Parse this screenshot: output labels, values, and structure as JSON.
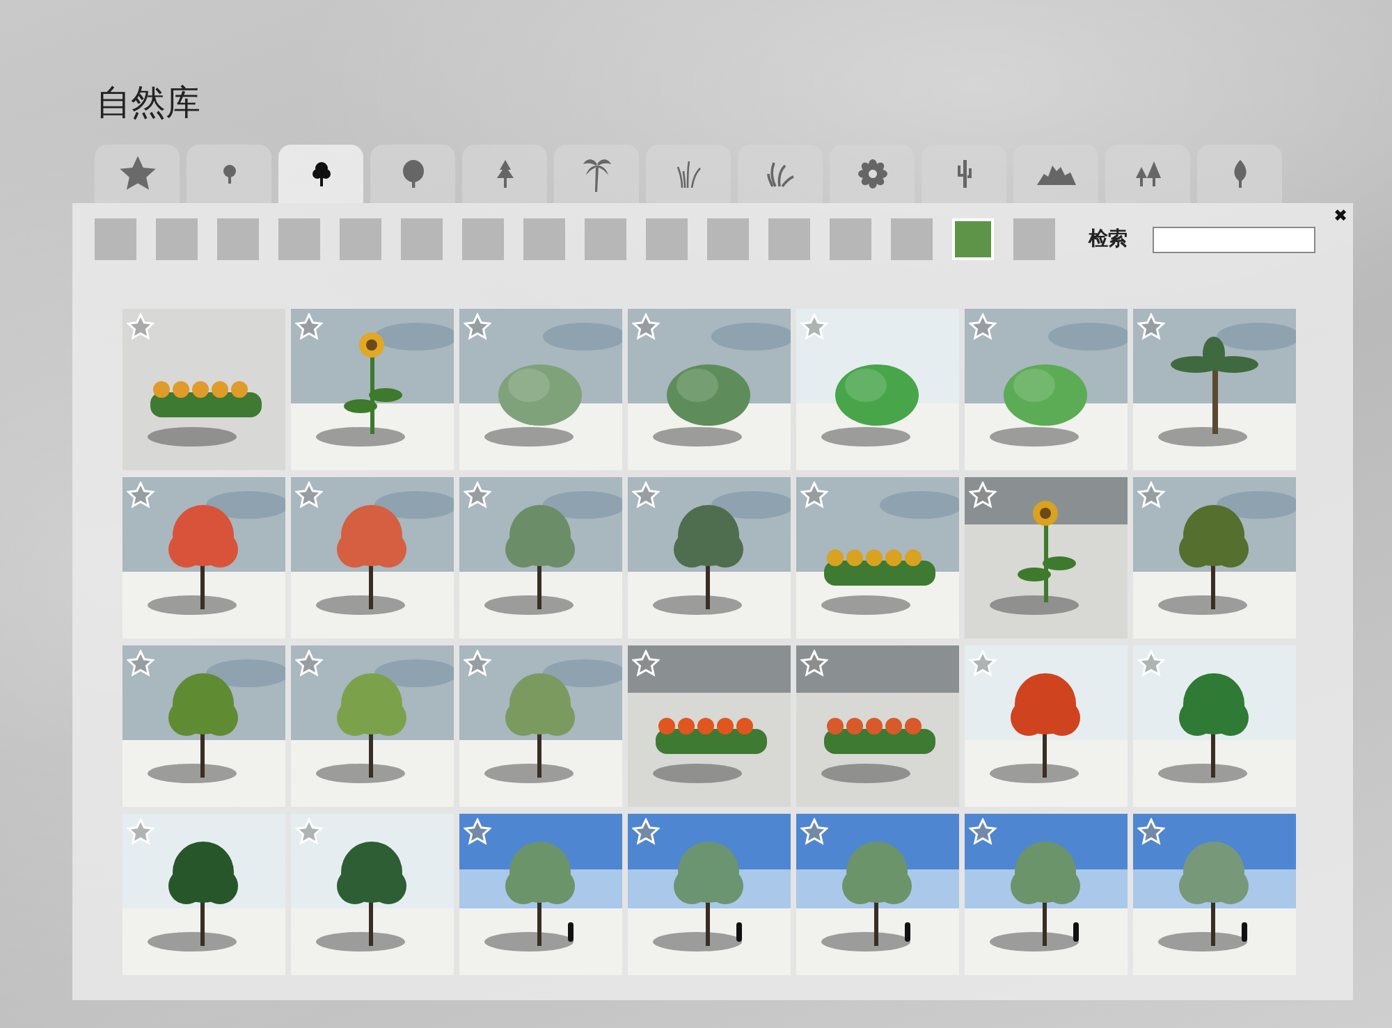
{
  "title": "自然库",
  "tabs": [
    {
      "kind": "favorites",
      "selected": false
    },
    {
      "kind": "small-tree",
      "selected": false
    },
    {
      "kind": "tree",
      "selected": true
    },
    {
      "kind": "big-tree",
      "selected": false
    },
    {
      "kind": "pine",
      "selected": false
    },
    {
      "kind": "palm",
      "selected": false
    },
    {
      "kind": "grass",
      "selected": false
    },
    {
      "kind": "reeds",
      "selected": false
    },
    {
      "kind": "flower",
      "selected": false
    },
    {
      "kind": "cactus",
      "selected": false
    },
    {
      "kind": "rocks",
      "selected": false
    },
    {
      "kind": "pines",
      "selected": false
    },
    {
      "kind": "leaf",
      "selected": false
    }
  ],
  "swatches": [
    {
      "selected": false
    },
    {
      "selected": false
    },
    {
      "selected": false
    },
    {
      "selected": false
    },
    {
      "selected": false
    },
    {
      "selected": false
    },
    {
      "selected": false
    },
    {
      "selected": false
    },
    {
      "selected": false
    },
    {
      "selected": false
    },
    {
      "selected": false
    },
    {
      "selected": false
    },
    {
      "selected": false
    },
    {
      "selected": false
    },
    {
      "selected": true
    },
    {
      "selected": false
    }
  ],
  "search": {
    "label": "检索"
  },
  "close": "✖"
}
